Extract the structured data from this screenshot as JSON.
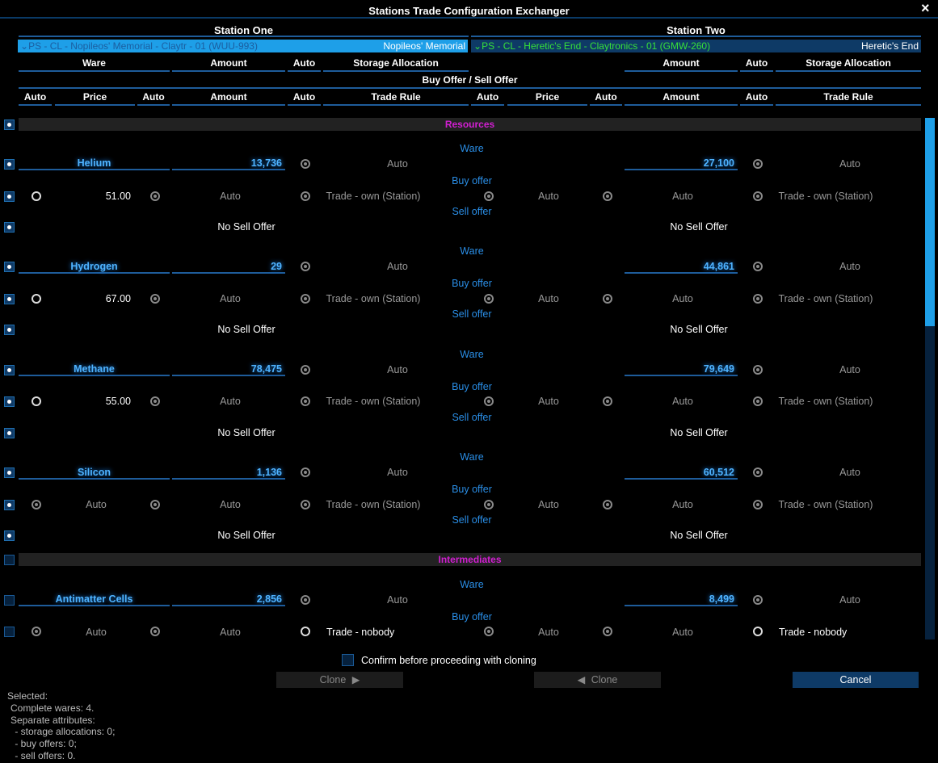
{
  "title": "Stations Trade Configuration Exchanger",
  "close_icon": "×",
  "station_one": {
    "title": "Station One",
    "dropdown": "PS - CL - Nopileos' Memorial - Claytr - 01 (WUU-993)",
    "dropdown_short": "Nopileos' Memorial"
  },
  "station_two": {
    "title": "Station Two",
    "dropdown": "PS - CL - Heretic's End - Claytronics - 01 (GMW-260)",
    "dropdown_short": "Heretic's End"
  },
  "headers": {
    "ware": "Ware",
    "amount": "Amount",
    "auto": "Auto",
    "storage": "Storage Allocation",
    "buysell": "Buy Offer / Sell Offer",
    "price": "Price",
    "trade_rule": "Trade Rule"
  },
  "labels": {
    "ware": "Ware",
    "buy_offer": "Buy offer",
    "sell_offer": "Sell offer",
    "no_sell": "No Sell Offer",
    "auto": "Auto"
  },
  "sections": {
    "resources": "Resources",
    "intermediates": "Intermediates"
  },
  "wares": [
    {
      "name": "Helium",
      "amount1": "13,736",
      "amount2": "27,100",
      "price1": "51.00",
      "rule1": "Trade - own (Station)",
      "rule2": "Trade - own (Station)"
    },
    {
      "name": "Hydrogen",
      "amount1": "29",
      "amount2": "44,861",
      "price1": "67.00",
      "rule1": "Trade - own (Station)",
      "rule2": "Trade - own (Station)"
    },
    {
      "name": "Methane",
      "amount1": "78,475",
      "amount2": "79,649",
      "price1": "55.00",
      "rule1": "Trade - own (Station)",
      "rule2": "Trade - own (Station)"
    },
    {
      "name": "Silicon",
      "amount1": "1,136",
      "amount2": "60,512",
      "price1": "Auto",
      "rule1": "Trade - own (Station)",
      "rule2": "Trade - own (Station)"
    },
    {
      "name": "Antimatter Cells",
      "amount1": "2,856",
      "amount2": "8,499",
      "price1": "Auto",
      "rule1": "Trade - nobody",
      "rule2": "Trade - nobody"
    }
  ],
  "confirm_label": "Confirm before proceeding with cloning",
  "buttons": {
    "clone_right": "Clone",
    "clone_left": "Clone",
    "cancel": "Cancel"
  },
  "status": {
    "selected": "Selected:",
    "complete": "Complete wares: 4.",
    "separate": "Separate attributes:",
    "storage": " - storage allocations: 0;",
    "buy": " - buy offers: 0;",
    "sell": " - sell offers: 0."
  },
  "colors": {
    "accent": "#1e9fe8",
    "ware_text": "#4fb3ff",
    "section": "#d21fd2",
    "green": "#37e03a"
  }
}
